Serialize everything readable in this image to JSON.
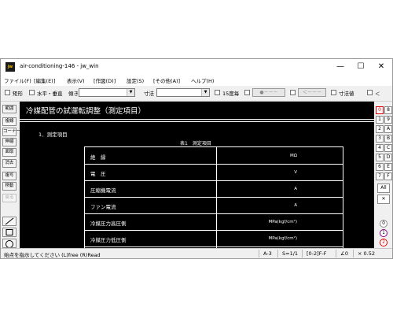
{
  "window": {
    "app_icon": "jw",
    "title": "air-conditioning-146 - jw_win",
    "minimize": "—",
    "maximize": "☐",
    "close": "✕"
  },
  "menu": [
    "ファイル(F)",
    "[編集(E)]",
    "表示(V)",
    "[作図(D)]",
    "設定(S)",
    "[その他(A)]",
    "ヘルプ(H)"
  ],
  "toolbar": {
    "rect": "矩形",
    "horiz_vert": "水平・垂直",
    "ratio_label": "傾き",
    "size_label": "寸法",
    "deg15": "15度毎",
    "btn_a": "●－－－",
    "btn_b": "＜－－－",
    "dim_value": "寸法値",
    "last": "＜"
  },
  "left_tools": [
    "範囲",
    "複線",
    "コーナー",
    "伸縮",
    "面取",
    "消去",
    "複写",
    "移動",
    "戻る"
  ],
  "right_layers": {
    "row1": [
      "0",
      "8"
    ],
    "row2": [
      "1",
      "9"
    ],
    "row3": [
      "2",
      "A"
    ],
    "row4": [
      "3",
      "B"
    ],
    "row5": [
      "4",
      "C"
    ],
    "row6": [
      "5",
      "D"
    ],
    "row7": [
      "6",
      "E"
    ],
    "row8": [
      "7",
      "F"
    ],
    "all": "All",
    "x": "✕",
    "g0": "0",
    "g1": "1",
    "g2": "2"
  },
  "drawing": {
    "title": "冷媒配管の試運転調整（測定項目）",
    "section": "1．測定項目",
    "table_caption": "表1　測定項目",
    "rows": [
      {
        "label": "絶　縁",
        "unit": "MΩ"
      },
      {
        "label": "電　圧",
        "unit": "V"
      },
      {
        "label": "圧縮機電流",
        "unit": "A"
      },
      {
        "label": "ファン電流",
        "unit": "A"
      },
      {
        "label": "冷媒圧力高圧側",
        "unit": "MPa(kgf/cm²)"
      },
      {
        "label": "冷媒圧力低圧側",
        "unit": "MPa(kgf/cm²)"
      }
    ]
  },
  "status": {
    "message": "始点を指示してください (L)free (R)Read",
    "paper": "A-3",
    "scale": "S=1/1",
    "layer": "[0-2]F-F",
    "angle": "∠0",
    "zoom": "× 0.52"
  }
}
